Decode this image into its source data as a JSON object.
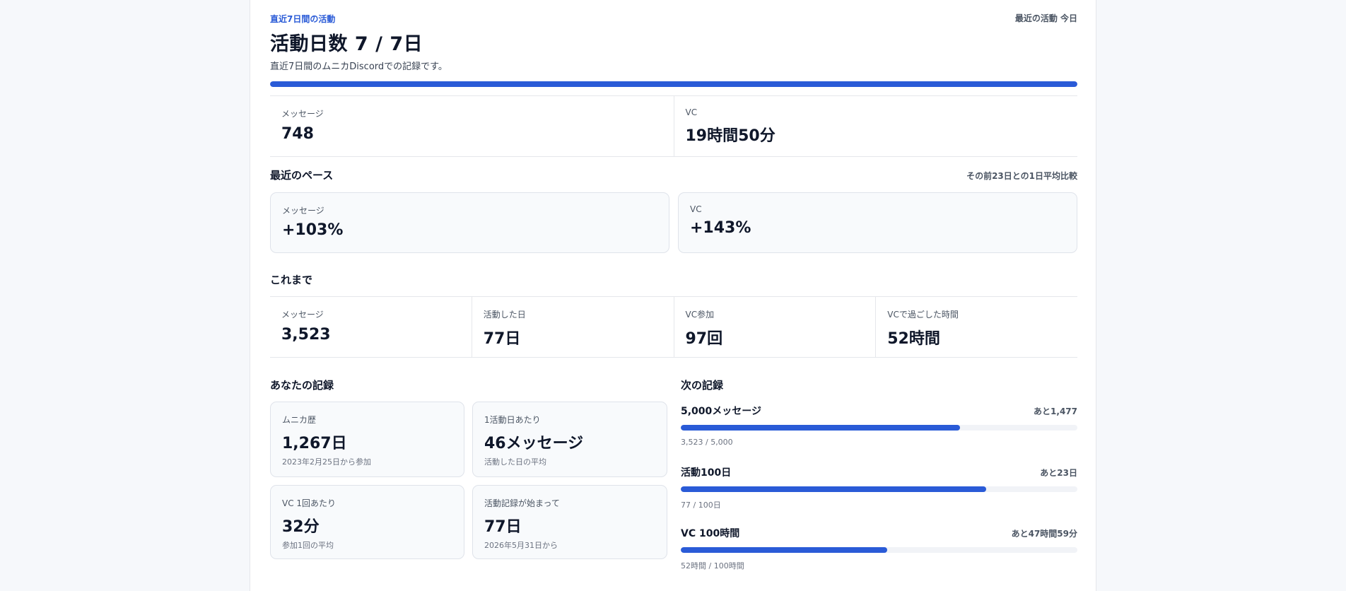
{
  "header": {
    "eyebrow": "直近7日間の活動",
    "last_activity": "最近の活動 今日",
    "title": "活動日数 7 / 7日",
    "subtitle": "直近7日間のムニカDiscordでの記録です。",
    "progress": 1.0
  },
  "week_stats": [
    {
      "label": "メッセージ",
      "value": "748"
    },
    {
      "label": "VC",
      "value": "19時間50分"
    }
  ],
  "pace": {
    "title": "最近のペース",
    "note": "その前23日との1日平均比較",
    "items": [
      {
        "label": "メッセージ",
        "value": "+103%"
      },
      {
        "label": "VC",
        "value": "+143%"
      }
    ]
  },
  "totals": {
    "title": "これまで",
    "items": [
      {
        "label": "メッセージ",
        "value": "3,523"
      },
      {
        "label": "活動した日",
        "value": "77日"
      },
      {
        "label": "VC参加",
        "value": "97回"
      },
      {
        "label": "VCで過ごした時間",
        "value": "52時間"
      }
    ]
  },
  "records": {
    "title": "あなたの記録",
    "items": [
      {
        "label": "ムニカ歴",
        "value": "1,267日",
        "sub": "2023年2月25日から参加"
      },
      {
        "label": "1活動日あたり",
        "value": "46メッセージ",
        "sub": "活動した日の平均"
      },
      {
        "label": "VC 1回あたり",
        "value": "32分",
        "sub": "参加1回の平均"
      },
      {
        "label": "活動記録が始まって",
        "value": "77日",
        "sub": "2026年5月31日から"
      }
    ]
  },
  "next": {
    "title": "次の記録",
    "goals": [
      {
        "title": "5,000メッセージ",
        "remain": "あと1,477",
        "progress_text": "3,523 / 5,000",
        "fraction": 0.7046
      },
      {
        "title": "活動100日",
        "remain": "あと23日",
        "progress_text": "77 / 100日",
        "fraction": 0.77
      },
      {
        "title": "VC 100時間",
        "remain": "あと47時間59分",
        "progress_text": "52時間 / 100時間",
        "fraction": 0.52
      }
    ]
  },
  "colors": {
    "accent": "#2a5bd7",
    "track": "#f1f3f7",
    "box_bg": "#f8fafc"
  }
}
